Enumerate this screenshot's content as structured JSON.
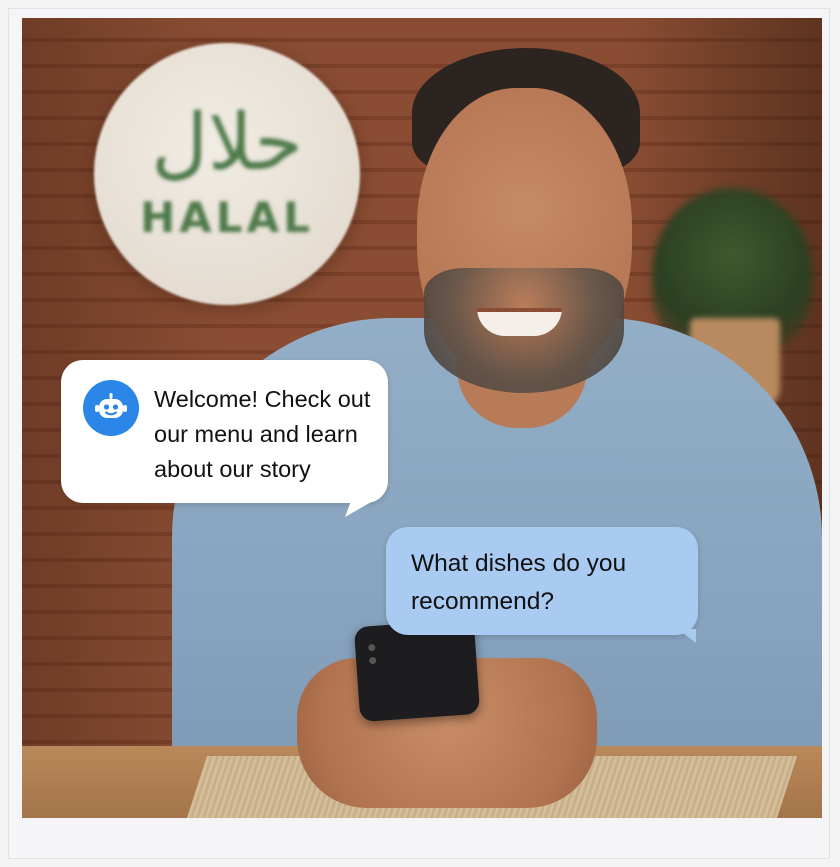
{
  "sign": {
    "arabic": "حلال",
    "latin": "HALAL"
  },
  "chat": {
    "bot_message": "Welcome! Check out our menu and learn about our story",
    "bot_avatar_icon": "robot-face-icon",
    "user_message": "What dishes do you recommend?"
  },
  "colors": {
    "bot_avatar": "#2b86e8",
    "bot_bubble": "#ffffff",
    "user_bubble": "#a9cbf2"
  }
}
